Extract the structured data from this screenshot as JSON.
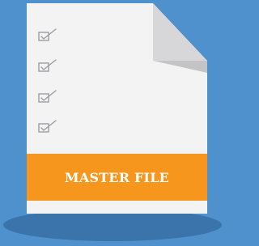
{
  "banner": {
    "label": "MASTER FILE"
  },
  "checklist": {
    "items": [
      {
        "icon": "checkbox-checked-icon"
      },
      {
        "icon": "checkbox-checked-icon"
      },
      {
        "icon": "checkbox-checked-icon"
      },
      {
        "icon": "checkbox-checked-icon"
      }
    ]
  },
  "colors": {
    "background": "#4f91cd",
    "shadow": "#3a74aa",
    "document": "#f3f3f4",
    "fold": "#d7d7d9",
    "check": "#9d9da0",
    "banner": "#f7961d",
    "banner_text": "#ffffff"
  }
}
